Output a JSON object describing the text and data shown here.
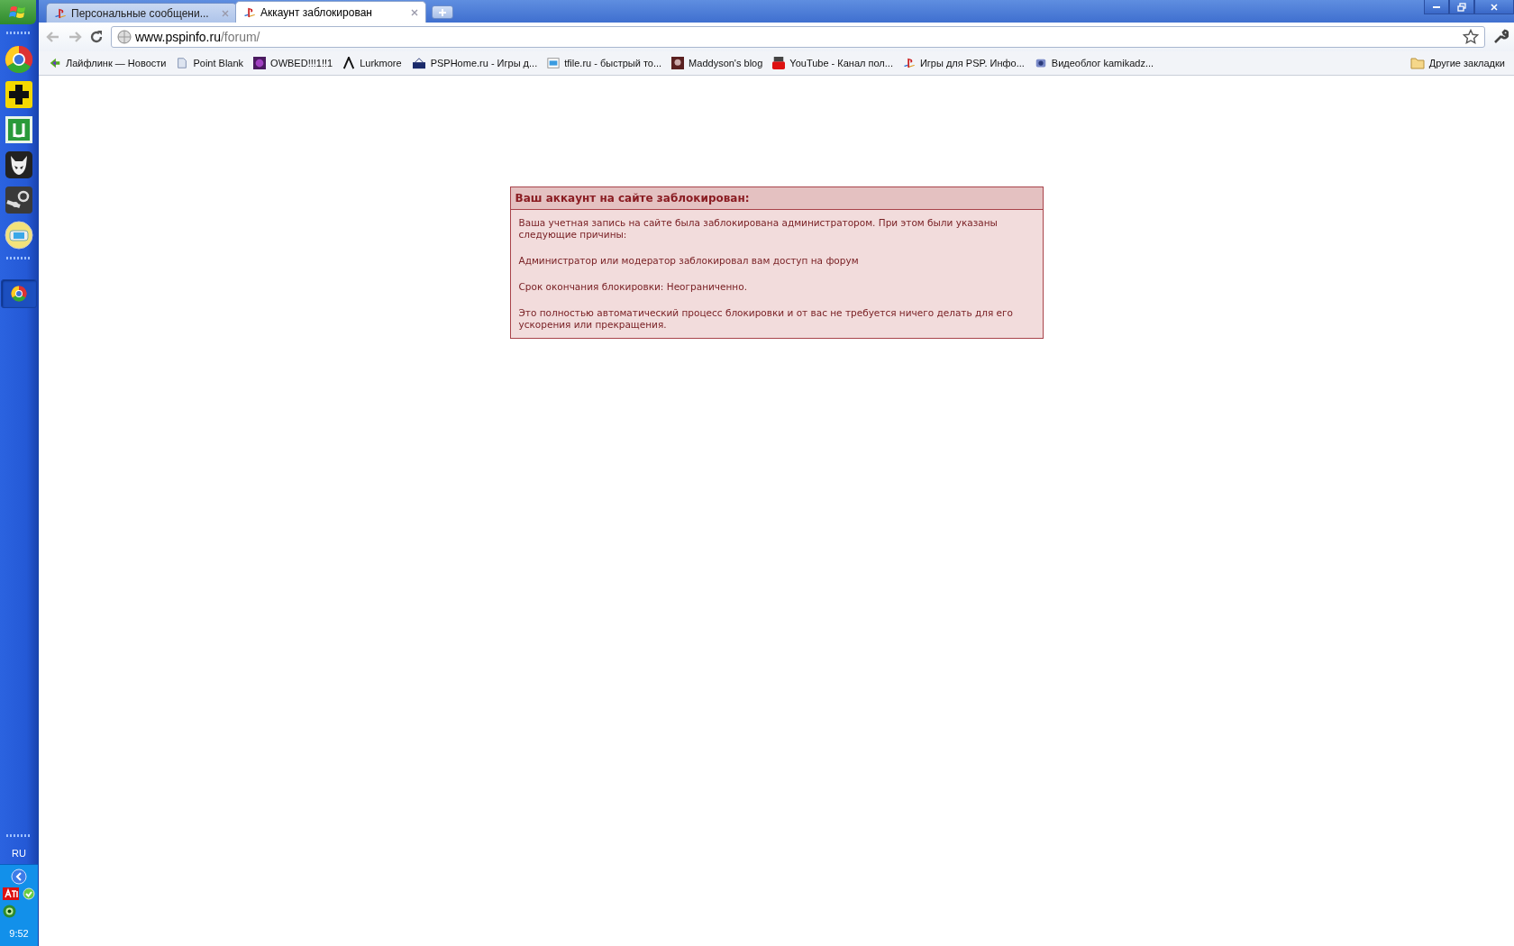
{
  "taskbar": {
    "language": "RU",
    "clock": "9:52"
  },
  "tabs": [
    {
      "title": "Персональные сообщени...",
      "selected": false
    },
    {
      "title": "Аккаунт заблокирован",
      "selected": true
    }
  ],
  "address": {
    "host": "www.pspinfo.ru",
    "path": "/forum/"
  },
  "bookmarks": [
    "Лайфлинк — Новости",
    "Point Blank",
    "OWBED!!!1!!1",
    "Lurkmore",
    "PSPHome.ru - Игры д...",
    "tfile.ru - быстрый то...",
    "Maddyson's blog",
    "YouTube - Канал пол...",
    "Игры для PSP. Инфо...",
    "Видеоблог kamikadz..."
  ],
  "other_bookmarks": "Другие закладки",
  "notice": {
    "title": "Ваш аккаунт на сайте заблокирован:",
    "paragraphs": [
      "Ваша учетная запись на сайте была заблокирована администратором. При этом были указаны следующие причины:",
      "Администратор или модератор заблокировал вам доступ на форум",
      "Срок окончания блокировки: Неограниченно.",
      "Это полностью автоматический процесс блокировки и от вас не требуется ничего делать для его ускорения или прекращения."
    ]
  }
}
